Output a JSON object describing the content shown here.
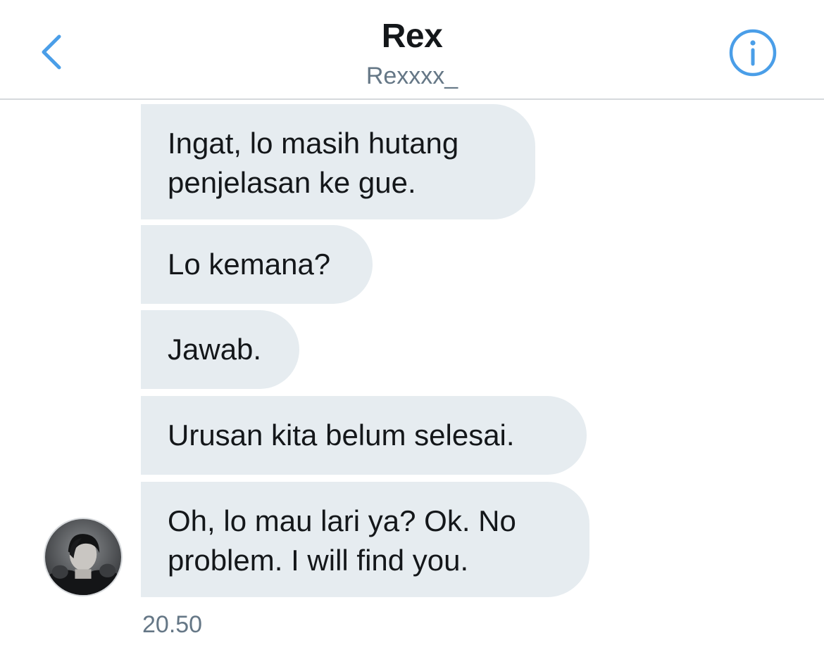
{
  "header": {
    "title": "Rex",
    "handle": "Rexxxx_",
    "back_icon": "chevron-left-icon",
    "info_icon": "info-circle-icon"
  },
  "colors": {
    "accent": "#4a9ee8",
    "bubble": "#e6ecf0",
    "text": "#14171a",
    "muted": "#657786"
  },
  "messages": [
    {
      "text": "Ingat, lo masih hutang\npenjelasan ke gue."
    },
    {
      "text": "Lo kemana?"
    },
    {
      "text": "Jawab."
    },
    {
      "text": "Urusan kita belum selesai."
    },
    {
      "text": "Oh, lo mau lari ya? Ok. No\nproblem. I will find you."
    }
  ],
  "timestamp": "20.50"
}
